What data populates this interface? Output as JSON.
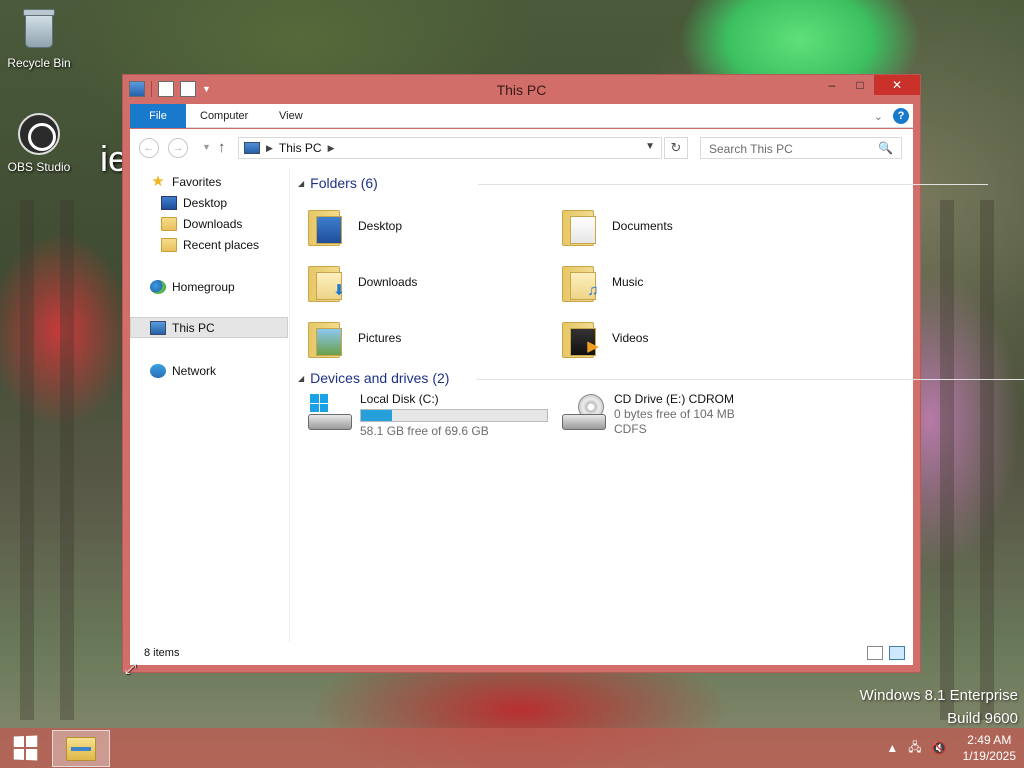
{
  "desktop": {
    "icons": [
      {
        "label": "Recycle Bin"
      },
      {
        "label": "OBS Studio"
      }
    ],
    "stray_text": "ie",
    "watermark": {
      "line1": "Windows 8.1 Enterprise",
      "line2": "Build 9600"
    }
  },
  "window": {
    "title": "This PC",
    "caption": {
      "minimize": "–",
      "maximize": "□",
      "close": "✕"
    },
    "ribbon": {
      "tabs": [
        "File",
        "Computer",
        "View"
      ]
    },
    "nav": {
      "back": "←",
      "forward": "→",
      "up": "↑",
      "address": "This PC",
      "search_placeholder": "Search This PC"
    },
    "sidebar": {
      "favorites": "Favorites",
      "items": [
        "Desktop",
        "Downloads",
        "Recent places"
      ],
      "homegroup": "Homegroup",
      "this_pc": "This PC",
      "network": "Network"
    },
    "folders_header": "Folders (6)",
    "folders": [
      "Desktop",
      "Documents",
      "Downloads",
      "Music",
      "Pictures",
      "Videos"
    ],
    "drives_header": "Devices and drives (2)",
    "drives": [
      {
        "name": "Local Disk (C:)",
        "free": "58.1 GB free of 69.6 GB",
        "used_fraction": 0.166
      },
      {
        "name": "CD Drive (E:) CDROM",
        "free": "0 bytes free of 104 MB",
        "fs": "CDFS"
      }
    ],
    "status": "8 items"
  },
  "taskbar": {
    "time": "2:49 AM",
    "date": "1/19/2025"
  },
  "colors": {
    "window_frame": "#d16e6a",
    "accent": "#1979ca",
    "close_button": "#c9312a",
    "capacity_fill": "#26a0da"
  }
}
